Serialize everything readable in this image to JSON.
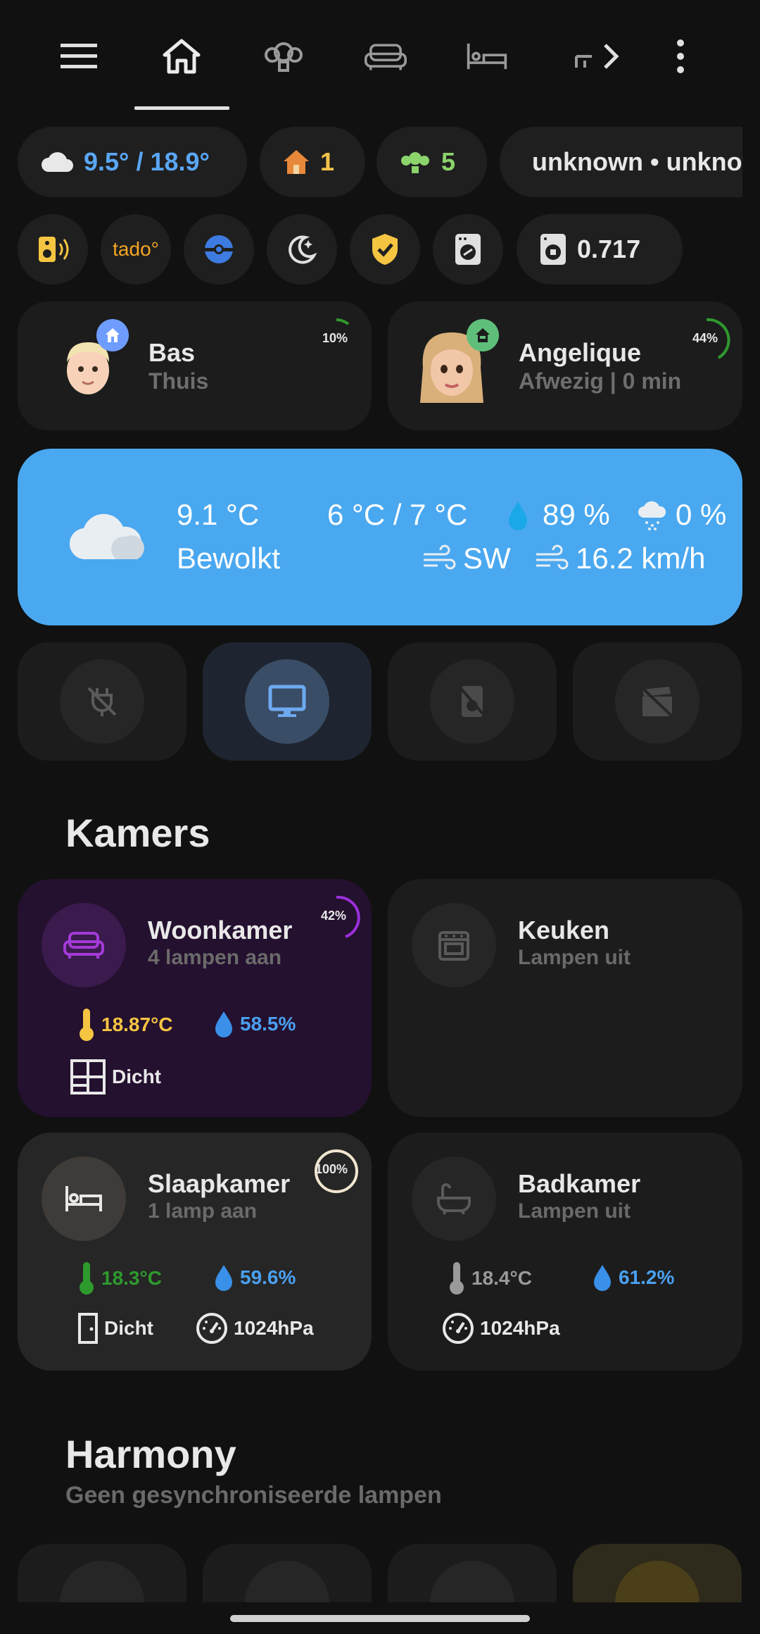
{
  "nav": {
    "items": [
      "menu-icon",
      "home-icon",
      "lightbulb-group-icon",
      "sofa-icon",
      "bed-icon",
      "partial-icon",
      "chevron-right-icon",
      "more-vert-icon"
    ]
  },
  "chips": {
    "weather": "9.5° / 18.9°",
    "home_count": "1",
    "lights_count": "5",
    "radio": "unknown • unknown"
  },
  "badges": {
    "power_value": "0.717",
    "tado_label": "tado°"
  },
  "persons": [
    {
      "name": "Bas",
      "status": "Thuis",
      "battery": "10%"
    },
    {
      "name": "Angelique",
      "status": "Afwezig | 0 min",
      "battery": "44%"
    }
  ],
  "weather": {
    "temp": "9.1 °C",
    "range": "6 °C / 7 °C",
    "humidity": "89 %",
    "precip": "0 %",
    "condition": "Bewolkt",
    "wind_dir": "SW",
    "wind_speed": "16.2 km/h"
  },
  "sections": {
    "rooms_title": "Kamers",
    "harmony_title": "Harmony",
    "harmony_sub": "Geen gesynchroniseerde lampen"
  },
  "rooms": [
    {
      "name": "Woonkamer",
      "sub": "4 lampen aan",
      "badge": "42%",
      "temp": "18.87°C",
      "hum": "58.5%",
      "window": "Dicht"
    },
    {
      "name": "Keuken",
      "sub": "Lampen uit"
    },
    {
      "name": "Slaapkamer",
      "sub": "1 lamp aan",
      "badge": "100%",
      "temp": "18.3°C",
      "hum": "59.6%",
      "door": "Dicht",
      "pressure": "1024hPa"
    },
    {
      "name": "Badkamer",
      "sub": "Lampen uit",
      "temp": "18.4°C",
      "hum": "61.2%",
      "pressure": "1024hPa"
    }
  ],
  "colors": {
    "bg": "#111111",
    "card": "#1c1c1c",
    "accent_blue": "#4aa8f0",
    "purple": "#9b30d9",
    "yellow": "#f5c542",
    "green": "#2e9a2e"
  }
}
